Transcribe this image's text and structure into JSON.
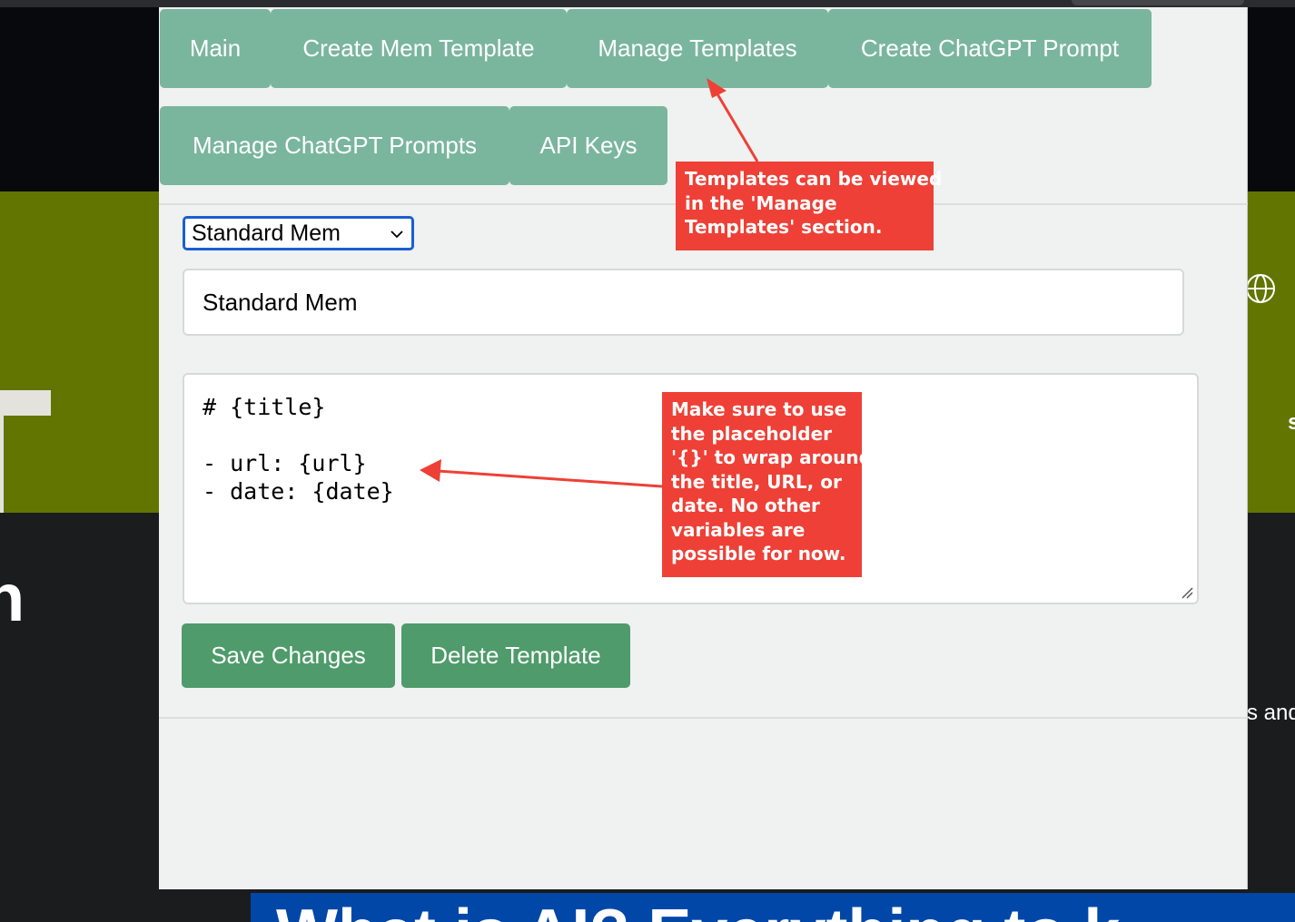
{
  "popup": {
    "tabs": [
      {
        "label": "Main"
      },
      {
        "label": "Create Mem Template"
      },
      {
        "label": "Manage Templates"
      },
      {
        "label": "Create ChatGPT Prompt"
      },
      {
        "label": "Manage ChatGPT Prompts"
      },
      {
        "label": "API Keys"
      }
    ],
    "template_select": {
      "selected": "Standard Mem"
    },
    "template_name": {
      "value": "Standard Mem"
    },
    "template_body": {
      "lines": [
        "# {title}",
        "",
        "- url: {url}",
        "- date: {date}"
      ]
    },
    "buttons": {
      "save": "Save Changes",
      "delete": "Delete Template"
    }
  },
  "annotations": {
    "manage_templates_note": {
      "lines": [
        "Templates can be viewed",
        "in the 'Manage",
        "Templates' section."
      ]
    },
    "placeholder_note": {
      "lines": [
        "Make sure to use",
        "the placeholder",
        "'{}' to wrap around",
        "the title, URL, or",
        "date. No other",
        "variables are",
        "possible for now."
      ]
    }
  },
  "background": {
    "partial_text_right": "s and",
    "banner_text": "What is AI? Everything to k"
  },
  "colors": {
    "tab_bg": "#7ab69d",
    "button_bg": "#4f9b6b",
    "callout_bg": "#ee4036",
    "select_focus": "#1a5fd1",
    "bg_olive": "#627500",
    "bg_blue": "#0047a8"
  },
  "icons": {
    "select_chevron": "chevron-down-icon",
    "resize": "resize-grip-icon",
    "background_globe": "globe-icon"
  }
}
